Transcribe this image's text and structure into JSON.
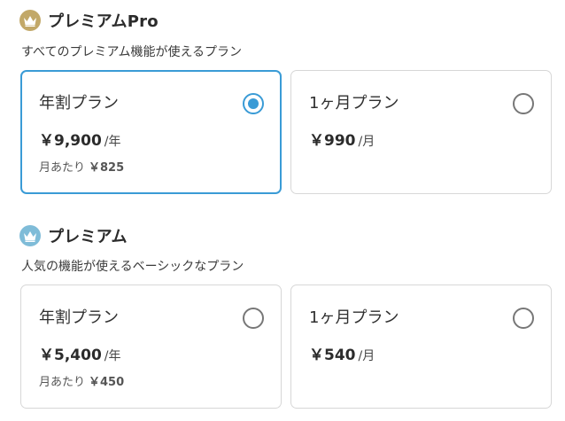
{
  "sections": [
    {
      "title": "プレミアムPro",
      "description": "すべてのプレミアム機能が使えるプラン",
      "crown_color": "#c2a868",
      "icon": "crown-icon",
      "plans": [
        {
          "name": "年割プラン",
          "price": "￥9,900",
          "unit": "/年",
          "monthly_label": "月あたり",
          "monthly_price": "￥825",
          "selected": true
        },
        {
          "name": "1ヶ月プラン",
          "price": "￥990",
          "unit": "/月",
          "selected": false
        }
      ]
    },
    {
      "title": "プレミアム",
      "description": "人気の機能が使えるベーシックなプラン",
      "crown_color": "#7fbcd8",
      "icon": "crown-icon",
      "plans": [
        {
          "name": "年割プラン",
          "price": "￥5,400",
          "unit": "/年",
          "monthly_label": "月あたり",
          "monthly_price": "￥450",
          "selected": false
        },
        {
          "name": "1ヶ月プラン",
          "price": "￥540",
          "unit": "/月",
          "selected": false
        }
      ]
    }
  ],
  "colors": {
    "accent": "#3a9bd6",
    "border": "#d7d7d7"
  }
}
